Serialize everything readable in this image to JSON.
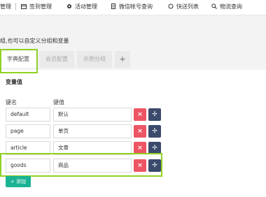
{
  "nav": {
    "items": [
      {
        "label": "管理"
      },
      {
        "label": "签到管理"
      },
      {
        "label": "活动管理"
      },
      {
        "label": "微信帐号查询"
      },
      {
        "label": "快送列表"
      },
      {
        "label": "物流查询"
      }
    ]
  },
  "description": "组,也可以自定义分组和变量",
  "tabs": [
    {
      "label": "字典配置"
    },
    {
      "label": "会员配置"
    },
    {
      "label": "示例分组"
    },
    {
      "label": "+"
    }
  ],
  "section_title": "变量值",
  "columns": {
    "name": "键名",
    "value": "键值"
  },
  "rows": [
    {
      "key": "default",
      "value": "默认"
    },
    {
      "key": "page",
      "value": "单页"
    },
    {
      "key": "article",
      "value": "文章"
    },
    {
      "key": "goods",
      "value": "商品"
    }
  ],
  "buttons": {
    "delete": "×",
    "move": "✢",
    "add": "+ 添加"
  },
  "colors": {
    "highlight": "#8fd124",
    "delete": "#ed5565",
    "move": "#3b4a6b",
    "add": "#1ab394"
  }
}
